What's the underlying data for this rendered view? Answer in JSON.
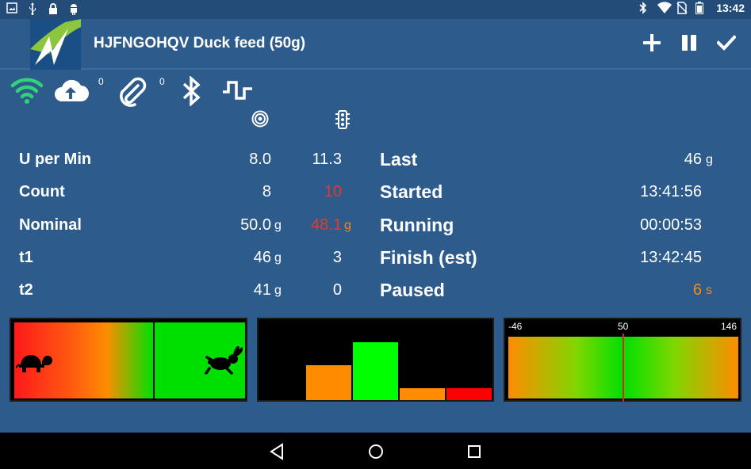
{
  "status_bar": {
    "time": "13:42",
    "left_icons": [
      "image-icon",
      "usb-icon",
      "lock-icon",
      "android-icon"
    ],
    "right_icons": [
      "bluetooth-icon",
      "wifi-icon",
      "no-sim-icon",
      "battery-icon"
    ]
  },
  "action_bar": {
    "title": "HJFNGOHQV Duck feed (50g)",
    "actions": [
      "add-icon",
      "pause-icon",
      "check-icon"
    ]
  },
  "icon_row": {
    "upload_count": "0",
    "attachment_count": "0"
  },
  "table": {
    "rows": [
      {
        "label": "U per Min",
        "v1": "8.0",
        "u1": "",
        "v2": "11.3",
        "u2": "",
        "rlabel": "Last",
        "rval": "46",
        "runit": "g"
      },
      {
        "label": "Count",
        "v1": "8",
        "u1": "",
        "v2": "10",
        "u2": "",
        "rlabel": "Started",
        "rval": "13:41:56",
        "runit": ""
      },
      {
        "label": "Nominal",
        "v1": "50.0",
        "u1": "g",
        "v2": "48.1",
        "u2": "g",
        "rlabel": "Running",
        "rval": "00:00:53",
        "runit": ""
      },
      {
        "label": "t1",
        "v1": "46",
        "u1": "g",
        "v2": "3",
        "u2": "",
        "rlabel": "Finish (est)",
        "rval": "13:42:45",
        "runit": ""
      },
      {
        "label": "t2",
        "v1": "41",
        "u1": "g",
        "v2": "0",
        "u2": "",
        "rlabel": "Paused",
        "rval": "6",
        "runit": "s"
      }
    ]
  },
  "speed_gauge": {
    "level": 0.6,
    "slow_icon": "turtle-icon",
    "fast_icon": "rabbit-icon"
  },
  "histogram": {
    "bars": [
      {
        "value": 3,
        "color": "#ff8c00"
      },
      {
        "value": 5,
        "color": "#00ff00"
      },
      {
        "value": 1,
        "color": "#ff8c00"
      },
      {
        "value": 1,
        "color": "#ff0000"
      }
    ],
    "max": 7
  },
  "range_gauge": {
    "min_label": "-46",
    "mid_label": "50",
    "max_label": "146",
    "min": -46,
    "max": 146,
    "marker": 50
  },
  "colors": {
    "background": "#2c5b8c",
    "green": "#00e000",
    "red": "#e23a2e",
    "orange": "#ef8a1e",
    "wifi": "#33d17a"
  }
}
